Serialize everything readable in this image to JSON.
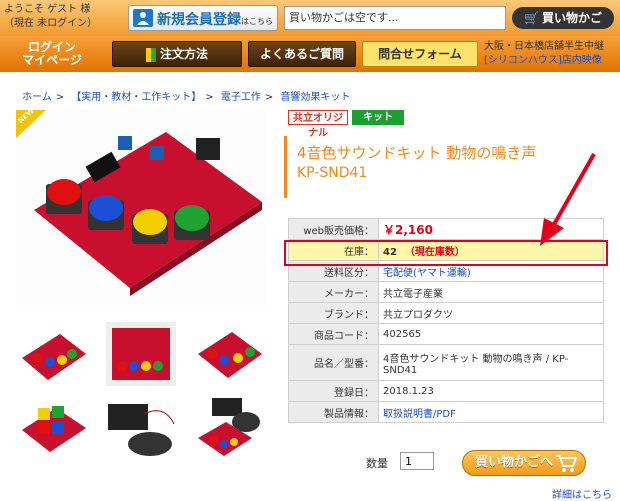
{
  "header": {
    "welcome": "ようこそ ゲスト 様\n（現在 未ログイン）",
    "register_main": "新規会員登録",
    "register_sub": "はこちら",
    "cart_status": "買い物かごは空です...",
    "cart_button": "買い物かご"
  },
  "nav": {
    "login": "ログイン\nマイページ",
    "order": "注文方法",
    "faq": "よくあるご質問",
    "form": "問合せフォーム",
    "store_line1": "大阪・日本橋店舗半生中継",
    "store_line2": "[シリコンハウス]店内映像"
  },
  "breadcrumb": [
    "ホーム",
    "【実用・教材・工作キット】",
    "電子工作",
    "音響効果キット"
  ],
  "product": {
    "new_label": "NEW",
    "badge_original": "共立オリジナル",
    "badge_kit": "キット",
    "title": "4音色サウンドキット 動物の鳴き声",
    "code_title": "KP-SND41",
    "specs": [
      {
        "key": "web販売価格：",
        "value": "￥2,160"
      },
      {
        "key": "在庫：",
        "value": "42",
        "note": "（現在庫数）"
      },
      {
        "key": "送料区分：",
        "value": "宅配便(ヤマト運輸)"
      },
      {
        "key": "メーカー：",
        "value": "共立電子産業"
      },
      {
        "key": "ブランド：",
        "value": "共立プロダクツ"
      },
      {
        "key": "商品コード：",
        "value": "402565"
      },
      {
        "key": "品名／型番：",
        "value": "4音色サウンドキット 動物の鳴き声 / KP-SND41"
      },
      {
        "key": "登録日：",
        "value": "2018.1.23"
      },
      {
        "key": "製品情報：",
        "value": "取扱説明書/PDF"
      }
    ],
    "quantity_label": "数量",
    "quantity_value": "1",
    "add_to_cart": "買い物かごへ",
    "details_link": "詳細はこちら"
  },
  "colors": {
    "accent": "#f28a1a",
    "price": "#e2001a",
    "link": "#1a4fb8",
    "stock_highlight": "#fff7a8"
  }
}
